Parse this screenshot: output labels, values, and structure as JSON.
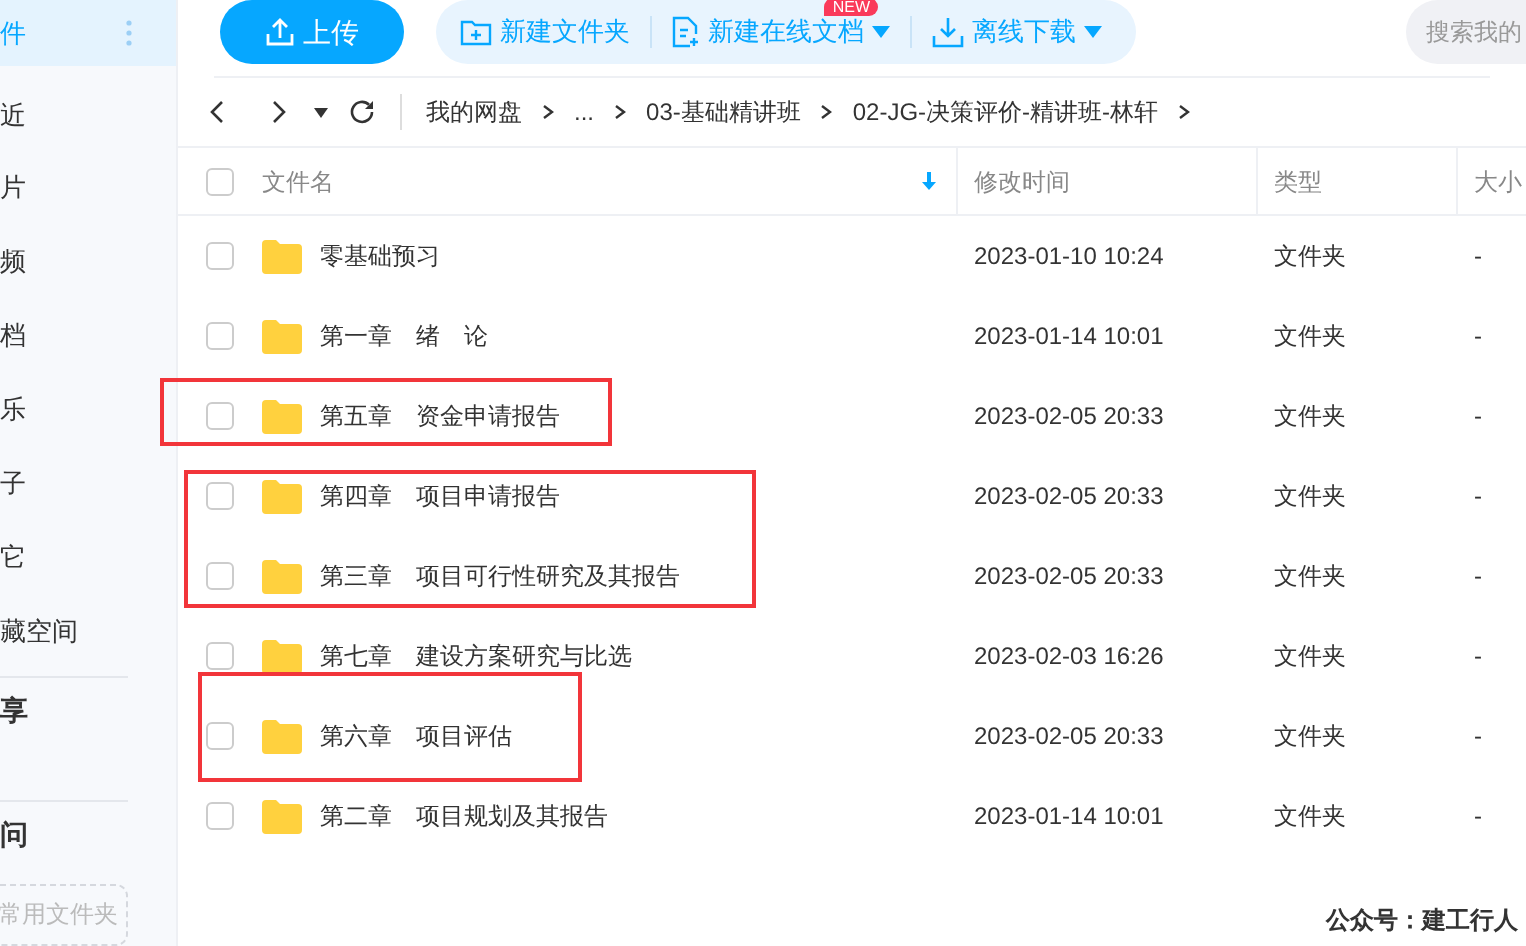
{
  "sidebar": {
    "items": [
      {
        "label": "件",
        "selected": true
      },
      {
        "label": "近",
        "selected": false
      },
      {
        "label": "片",
        "selected": false
      },
      {
        "label": "频",
        "selected": false
      },
      {
        "label": "档",
        "selected": false
      },
      {
        "label": "乐",
        "selected": false
      },
      {
        "label": "子",
        "selected": false
      },
      {
        "label": "它",
        "selected": false
      },
      {
        "label": "藏空间",
        "selected": false
      }
    ],
    "sections": [
      {
        "label": "享"
      },
      {
        "label": "问"
      }
    ],
    "add_folder": "常用文件夹"
  },
  "toolbar": {
    "upload": "上传",
    "actions": [
      {
        "label": "新建文件夹",
        "dropdown": false
      },
      {
        "label": "新建在线文档",
        "dropdown": true,
        "badge": "NEW"
      },
      {
        "label": "离线下载",
        "dropdown": true
      }
    ],
    "search": {
      "placeholder": "搜索我的"
    }
  },
  "breadcrumb": [
    "我的网盘",
    "...",
    "03-基础精讲班",
    "02-JG-决策评价-精讲班-林轩"
  ],
  "table": {
    "select_all_checked": false,
    "columns": [
      "文件名",
      "修改时间",
      "类型",
      "大小"
    ],
    "rows": [
      {
        "name": "零基础预习",
        "modified": "2023-01-10 10:24",
        "type": "文件夹",
        "size": "-",
        "checked": false
      },
      {
        "name": "第一章　绪　论",
        "modified": "2023-01-14 10:01",
        "type": "文件夹",
        "size": "-",
        "checked": false
      },
      {
        "name": "第五章　资金申请报告",
        "modified": "2023-02-05 20:33",
        "type": "文件夹",
        "size": "-",
        "checked": false
      },
      {
        "name": "第四章　项目申请报告",
        "modified": "2023-02-05 20:33",
        "type": "文件夹",
        "size": "-",
        "checked": false
      },
      {
        "name": "第三章　项目可行性研究及其报告",
        "modified": "2023-02-05 20:33",
        "type": "文件夹",
        "size": "-",
        "checked": false
      },
      {
        "name": "第七章　建设方案研究与比选",
        "modified": "2023-02-03 16:26",
        "type": "文件夹",
        "size": "-",
        "checked": false
      },
      {
        "name": "第六章　项目评估",
        "modified": "2023-02-05 20:33",
        "type": "文件夹",
        "size": "-",
        "checked": false
      },
      {
        "name": "第二章　项目规划及其报告",
        "modified": "2023-01-14 10:01",
        "type": "文件夹",
        "size": "-",
        "checked": false
      }
    ]
  },
  "annotations": [
    {
      "kind": "box"
    },
    {
      "kind": "box"
    },
    {
      "kind": "box"
    }
  ],
  "footer_text": "公众号：建工行人"
}
